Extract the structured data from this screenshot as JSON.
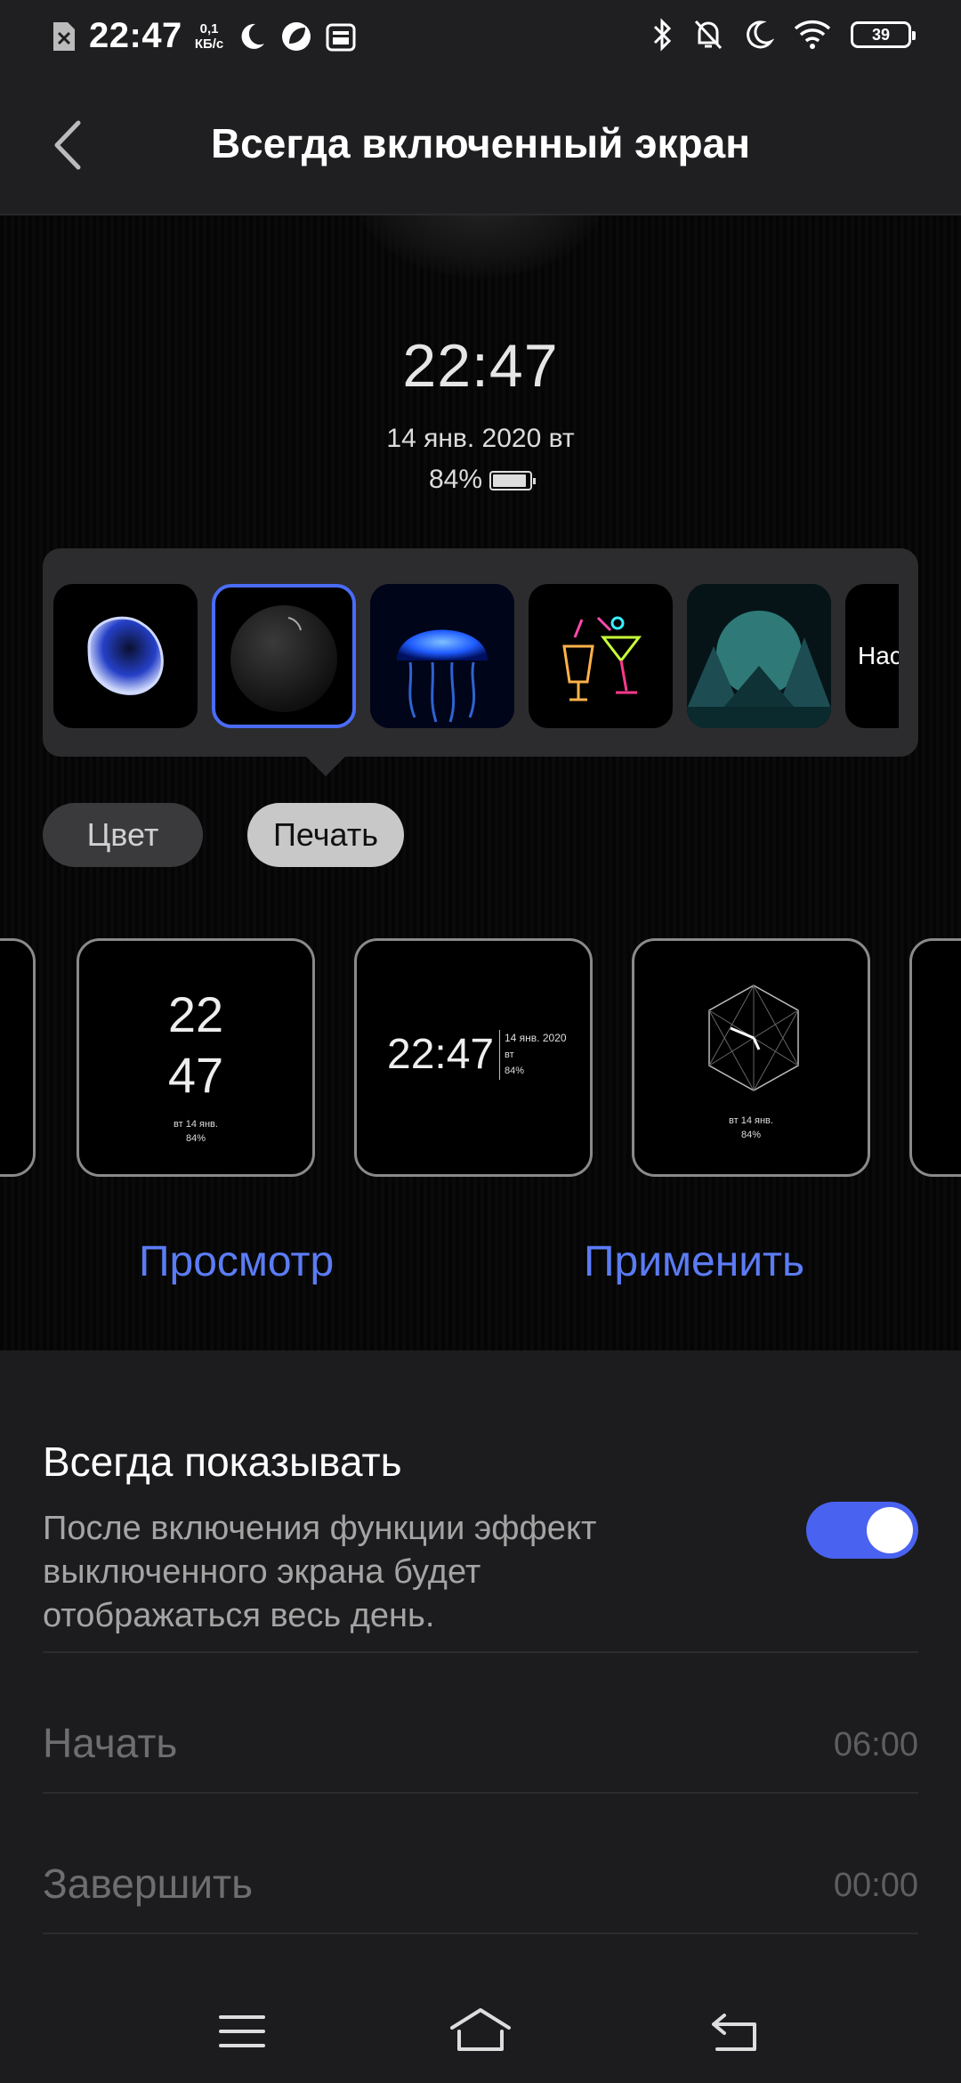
{
  "status_bar": {
    "time": "22:47",
    "speed_value": "0,1",
    "speed_unit": "КБ/с",
    "battery": "39"
  },
  "header": {
    "title": "Всегда включенный экран"
  },
  "aod_preview": {
    "time": "22:47",
    "date": "14 янв. 2020 вт",
    "battery": "84%"
  },
  "theme_thumbnails": {
    "items": [
      "blob",
      "dark-planet",
      "jellyfish",
      "neon-cocktails",
      "mountain-landscape"
    ],
    "selected_index": 1,
    "more_label": "Нас"
  },
  "tabs": {
    "color_label": "Цвет",
    "print_label": "Печать"
  },
  "clock_styles": {
    "card1": {
      "hour": "22",
      "minute": "47",
      "date": "вт 14 янв.",
      "battery": "84%"
    },
    "card2": {
      "time": "22:47",
      "date": "14 янв. 2020",
      "weekday": "вт",
      "battery": "84%"
    },
    "card3": {
      "date": "вт 14 янв.",
      "battery": "84%"
    }
  },
  "actions": {
    "preview_label": "Просмотр",
    "apply_label": "Применить"
  },
  "settings": {
    "always_show_title": "Всегда показывать",
    "always_show_desc": "После включения функции эффект выключенного экрана будет отображаться весь день.",
    "always_show_enabled": true,
    "start_label": "Начать",
    "start_value": "06:00",
    "end_label": "Завершить",
    "end_value": "00:00"
  },
  "colors": {
    "accent": "#4a6cf7",
    "background": "#1c1c1e"
  }
}
